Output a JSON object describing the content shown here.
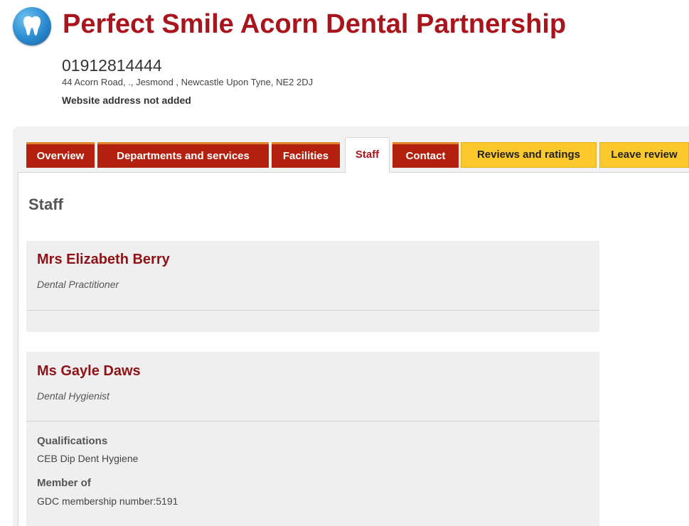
{
  "practice": {
    "name": "Perfect Smile Acorn Dental Partnership",
    "phone": "01912814444",
    "address": "44 Acorn Road, ., Jesmond , Newcastle Upon Tyne, NE2 2DJ",
    "website": "Website address not added",
    "logo_icon": "tooth-icon"
  },
  "tabs": [
    {
      "label": "Overview",
      "style": "red"
    },
    {
      "label": "Departments and services",
      "style": "red"
    },
    {
      "label": "Facilities",
      "style": "red"
    },
    {
      "label": "Staff",
      "style": "active"
    },
    {
      "label": "Contact",
      "style": "red"
    },
    {
      "label": "Reviews and ratings",
      "style": "yellow"
    },
    {
      "label": "Leave review",
      "style": "yellow"
    }
  ],
  "section_title": "Staff",
  "staff": [
    {
      "name": "Mrs Elizabeth Berry",
      "role": "Dental Practitioner"
    },
    {
      "name": "Ms Gayle Daws",
      "role": "Dental Hygienist",
      "qualifications_label": "Qualifications",
      "qualifications": "CEB Dip Dent Hygiene",
      "member_label": "Member of",
      "member": "GDC membership number:5191"
    }
  ],
  "colors": {
    "brand_red": "#a8151c",
    "tab_red": "#b3200e",
    "tab_yellow": "#fbc92c",
    "card_bg": "#efefef"
  }
}
